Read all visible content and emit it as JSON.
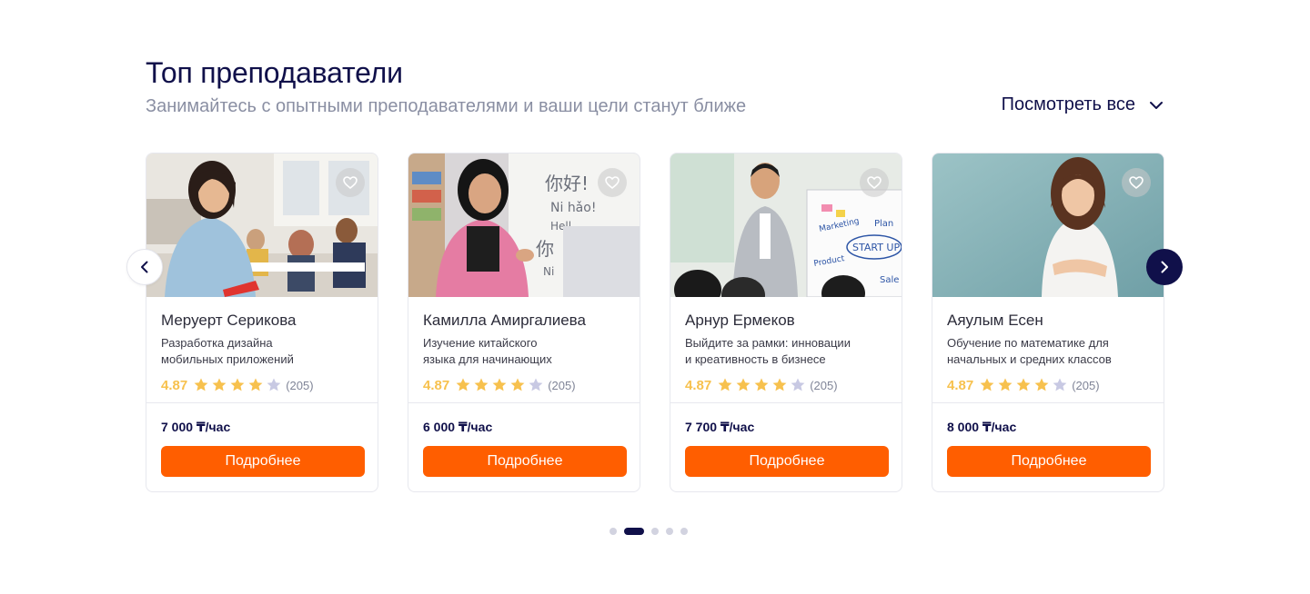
{
  "section": {
    "title": "Топ преподаватели",
    "subtitle": "Занимайтесь с опытными преподавателями и ваши цели станут ближе",
    "see_all": "Посмотреть все"
  },
  "cards": [
    {
      "name": "Меруерт Серикова",
      "description": "Разработка дизайна\nмобильных приложений",
      "rating": "4.87",
      "stars": 4,
      "reviews": "(205)",
      "price": "7 000 ₸/час",
      "button": "Подробнее"
    },
    {
      "name": "Камилла Амиргалиева",
      "description": "Изучение китайского\nязыка для начинающих",
      "rating": "4.87",
      "stars": 4,
      "reviews": "(205)",
      "price": "6 000 ₸/час",
      "button": "Подробнее",
      "board_text": [
        "你好!",
        "Ni hǎo!",
        "Hell",
        "你",
        "Ni"
      ]
    },
    {
      "name": "Арнур Ермеков",
      "description": "Выйдите за рамки: инновации\nи креативность в бизнесе",
      "rating": "4.87",
      "stars": 4,
      "reviews": "(205)",
      "price": "7 700 ₸/час",
      "button": "Подробнее",
      "board_text": [
        "Marketing",
        "Plan",
        "START UP",
        "Product",
        "Sale"
      ]
    },
    {
      "name": "Аяулым Есен",
      "description": "Обучение по математике для\nначальных и средних классов",
      "rating": "4.87",
      "stars": 4,
      "reviews": "(205)",
      "price": "8 000 ₸/час",
      "button": "Подробнее"
    }
  ],
  "pagination": {
    "total": 5,
    "active": 1
  },
  "colors": {
    "accent": "#ff5e00",
    "navy": "#10104a",
    "star_filled": "#f7c14e",
    "star_empty": "#c8c9e3"
  },
  "icons": [
    "chevron-down-icon",
    "heart-icon",
    "star-icon",
    "chevron-left-icon",
    "chevron-right-icon"
  ]
}
